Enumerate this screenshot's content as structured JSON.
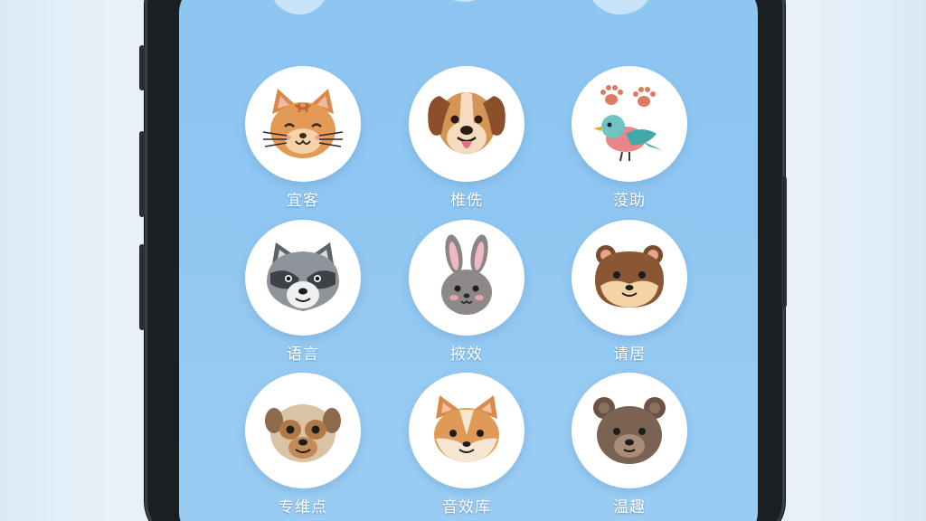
{
  "app": {
    "grid_items": [
      {
        "label": "宜客",
        "icon": "cat-face-icon"
      },
      {
        "label": "椎侁",
        "icon": "dog-face-icon"
      },
      {
        "label": "莈助",
        "icon": "bird-paw-icon"
      },
      {
        "label": "语言",
        "icon": "raccoon-face-icon"
      },
      {
        "label": "掖效",
        "icon": "rabbit-face-icon"
      },
      {
        "label": "请居",
        "icon": "hamster-face-icon"
      },
      {
        "label": "专维点",
        "icon": "pug-face-icon"
      },
      {
        "label": "音效库",
        "icon": "fox-face-icon"
      },
      {
        "label": "温趣",
        "icon": "bear-face-icon"
      }
    ]
  },
  "colors": {
    "screen_bg": "#8ec6f2",
    "circle_bg": "#ffffff",
    "label_text": "#ffffff"
  }
}
